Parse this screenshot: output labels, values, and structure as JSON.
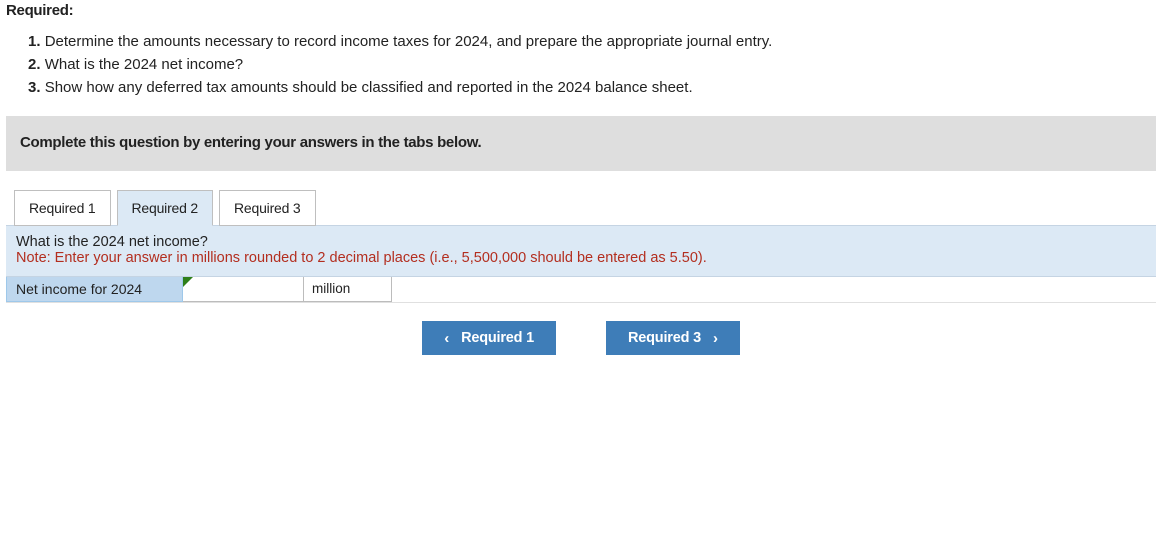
{
  "heading": "Required:",
  "requirements": [
    "Determine the amounts necessary to record income taxes for 2024, and prepare the appropriate journal entry.",
    "What is the 2024 net income?",
    "Show how any deferred tax amounts should be classified and reported in the 2024 balance sheet."
  ],
  "nums": [
    "1.",
    "2.",
    "3."
  ],
  "instruction": "Complete this question by entering your answers in the tabs below.",
  "tabs": [
    {
      "label": "Required 1"
    },
    {
      "label": "Required 2"
    },
    {
      "label": "Required 3"
    }
  ],
  "content": {
    "question": "What is the 2024 net income?",
    "note": "Note: Enter your answer in millions rounded to 2 decimal places (i.e., 5,500,000 should be entered as 5.50).",
    "row_label": "Net income for 2024",
    "input_value": "",
    "unit": "million"
  },
  "nav": {
    "prev": "Required 1",
    "next": "Required 3"
  }
}
